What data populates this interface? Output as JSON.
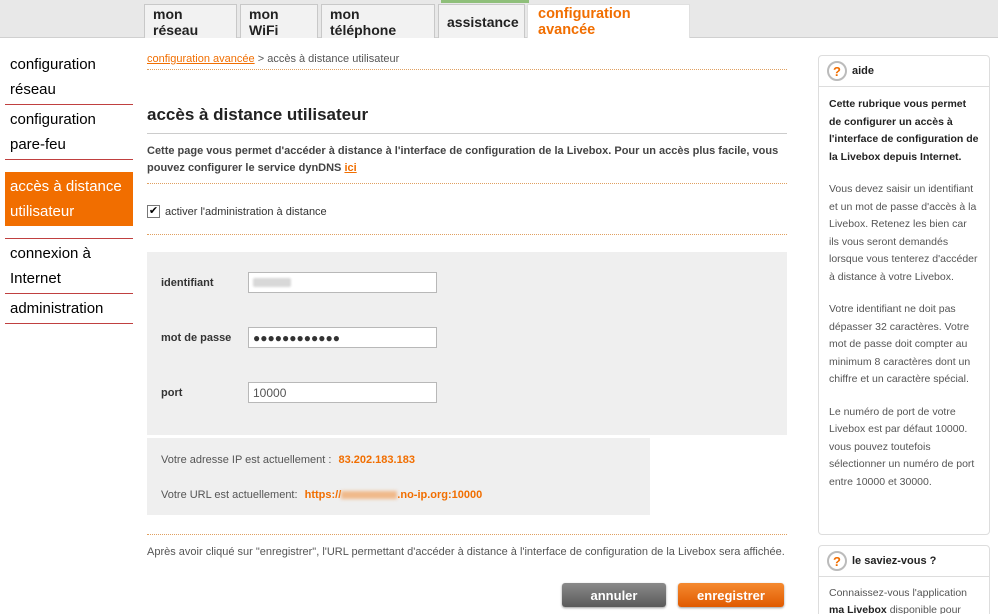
{
  "tabs": [
    {
      "label": "mon réseau"
    },
    {
      "label": "mon WiFi"
    },
    {
      "label": "mon téléphone"
    },
    {
      "label": "assistance"
    },
    {
      "label": "configuration avancée"
    }
  ],
  "sidebar": {
    "items": [
      {
        "label": "configuration réseau"
      },
      {
        "label": "configuration pare-feu"
      },
      {
        "label": "accès à distance utilisateur"
      },
      {
        "label": "connexion à Internet"
      },
      {
        "label": "administration"
      }
    ]
  },
  "breadcrumb": {
    "link": "configuration avancée",
    "separator": ">",
    "current": "accès à distance utilisateur"
  },
  "main": {
    "title": "accès à distance utilisateur",
    "intro": "Cette page vous permet d'accéder à distance à l'interface de configuration de la Livebox. Pour un accès plus facile, vous pouvez configurer le service dynDNS",
    "intro_link": "ici",
    "checkbox_label": "activer l'administration à distance",
    "checkbox_checked": true
  },
  "form": {
    "identifiant_label": "identifiant",
    "password_label": "mot de passe",
    "password_value": "●●●●●●●●●●●●",
    "port_label": "port",
    "port_value": "10000"
  },
  "info": {
    "ip_label": "Votre adresse IP est actuellement :",
    "ip_value": "83.202.183.183",
    "url_label": "Votre URL est actuellement:",
    "url_prefix": "https://",
    "url_suffix": ".no-ip.org:10000"
  },
  "note": "Après avoir cliqué sur \"enregistrer\", l'URL permettant d'accéder à distance à l'interface de configuration de la Livebox sera affichée.",
  "buttons": {
    "cancel": "annuler",
    "save": "enregistrer"
  },
  "aide": {
    "title": "aide",
    "lead": "Cette rubrique vous permet de configurer un accès à l'interface de configuration de la Livebox depuis Internet.",
    "p1": "Vous devez saisir un identifiant et un mot de passe d'accès à la Livebox. Retenez les bien car ils vous seront demandés lorsque vous tenterez d'accéder à distance à votre Livebox.",
    "p2": "Votre identifiant ne doit pas dépasser 32 caractères. Votre mot de passe doit compter au minimum 8 caractères dont un chiffre et un caractère spécial.",
    "p3": "Le numéro de port de votre Livebox est par défaut 10000. vous pouvez toutefois sélectionner un numéro de port entre 10000 et 30000."
  },
  "savez": {
    "title": "le saviez-vous ?",
    "text": "Connaissez-vous l'application",
    "bold": "ma Livebox",
    "text2": "disponible pour"
  },
  "colors": {
    "accent": "#f16e00"
  }
}
